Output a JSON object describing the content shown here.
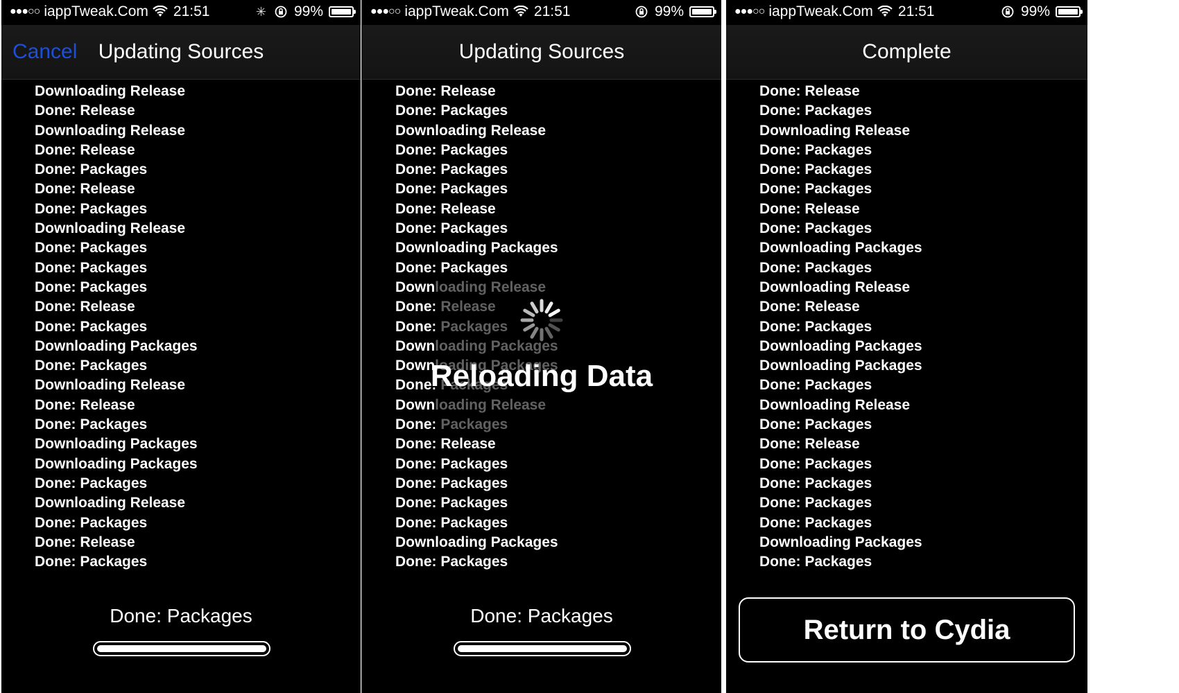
{
  "colors": {
    "background": "#000000",
    "text": "#ffffff",
    "cancel": "#1e4fd8"
  },
  "screens": [
    {
      "status": {
        "signal": "●●●○○",
        "carrier": "iappTweak.Com",
        "time": "21:51",
        "battery": "99%",
        "battery_level": 0.99,
        "icons": [
          "signal-icon",
          "wifi-icon",
          "activity-spinner-icon",
          "rotation-lock-icon",
          "battery-icon"
        ]
      },
      "nav": {
        "title": "Updating Sources",
        "cancel": "Cancel"
      },
      "log": [
        "Downloading Release",
        "Done: Release",
        "Downloading Release",
        "Done: Release",
        "Done: Packages",
        "Done: Release",
        "Done: Packages",
        "Downloading Release",
        "Done: Packages",
        "Done: Packages",
        "Done: Packages",
        "Done: Release",
        "Done: Packages",
        "Downloading Packages",
        "Done: Packages",
        "Downloading Release",
        "Done: Release",
        "Done: Packages",
        "Downloading Packages",
        "Downloading Packages",
        "Done: Packages",
        "Downloading Release",
        "Done: Packages",
        "Done: Release",
        "Done: Packages"
      ],
      "bottom_label": "Done: Packages",
      "progress": 1.0
    },
    {
      "status": {
        "signal": "●●●○○",
        "carrier": "iappTweak.Com",
        "time": "21:51",
        "battery": "99%",
        "battery_level": 0.99,
        "icons": [
          "signal-icon",
          "wifi-icon",
          "rotation-lock-icon",
          "battery-icon"
        ]
      },
      "nav": {
        "title": "Updating Sources"
      },
      "log": [
        "Done: Release",
        "Done: Packages",
        "Downloading Release",
        "Done: Packages",
        "Done: Packages",
        "Done: Packages",
        "Done: Release",
        "Done: Packages",
        "Downloading Packages",
        "Done: Packages",
        "Downloading Release",
        "Done: Release",
        "Done: Packages",
        "Downloading Packages",
        "Downloading Packages",
        "Done: Packages",
        "Downloading Release",
        "Done: Packages",
        "Done: Release",
        "Done: Packages",
        "Done: Packages",
        "Done: Packages",
        "Done: Packages",
        "Downloading Packages",
        "Done: Packages"
      ],
      "overlay": {
        "text": "Reloading Data",
        "icon": "spinner-icon"
      },
      "bottom_label": "Done: Packages",
      "progress": 1.0
    },
    {
      "status": {
        "signal": "●●●○○",
        "carrier": "iappTweak.Com",
        "time": "21:51",
        "battery": "99%",
        "battery_level": 0.99,
        "icons": [
          "signal-icon",
          "wifi-icon",
          "rotation-lock-icon",
          "battery-icon"
        ]
      },
      "nav": {
        "title": "Complete"
      },
      "log": [
        "Done: Release",
        "Done: Packages",
        "Downloading Release",
        "Done: Packages",
        "Done: Packages",
        "Done: Packages",
        "Done: Release",
        "Done: Packages",
        "Downloading Packages",
        "Done: Packages",
        "Downloading Release",
        "Done: Release",
        "Done: Packages",
        "Downloading Packages",
        "Downloading Packages",
        "Done: Packages",
        "Downloading Release",
        "Done: Packages",
        "Done: Release",
        "Done: Packages",
        "Done: Packages",
        "Done: Packages",
        "Done: Packages",
        "Downloading Packages",
        "Done: Packages"
      ],
      "button": "Return to Cydia"
    }
  ]
}
